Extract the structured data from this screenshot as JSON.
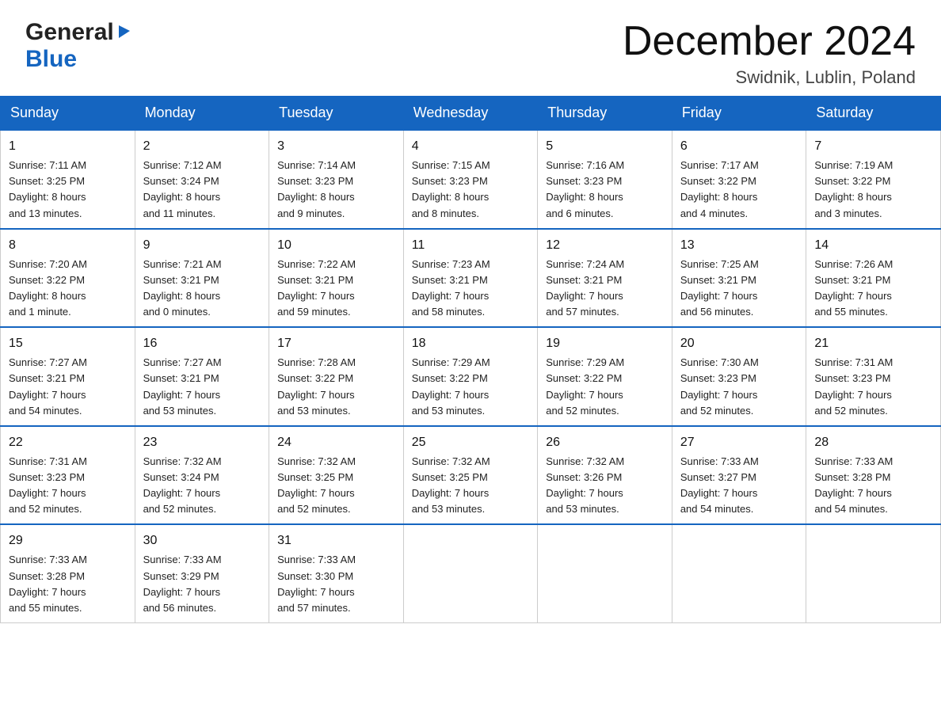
{
  "logo": {
    "general": "General",
    "blue": "Blue",
    "triangle": "▶"
  },
  "title": "December 2024",
  "location": "Swidnik, Lublin, Poland",
  "weekdays": [
    "Sunday",
    "Monday",
    "Tuesday",
    "Wednesday",
    "Thursday",
    "Friday",
    "Saturday"
  ],
  "weeks": [
    [
      {
        "day": "1",
        "info": "Sunrise: 7:11 AM\nSunset: 3:25 PM\nDaylight: 8 hours\nand 13 minutes."
      },
      {
        "day": "2",
        "info": "Sunrise: 7:12 AM\nSunset: 3:24 PM\nDaylight: 8 hours\nand 11 minutes."
      },
      {
        "day": "3",
        "info": "Sunrise: 7:14 AM\nSunset: 3:23 PM\nDaylight: 8 hours\nand 9 minutes."
      },
      {
        "day": "4",
        "info": "Sunrise: 7:15 AM\nSunset: 3:23 PM\nDaylight: 8 hours\nand 8 minutes."
      },
      {
        "day": "5",
        "info": "Sunrise: 7:16 AM\nSunset: 3:23 PM\nDaylight: 8 hours\nand 6 minutes."
      },
      {
        "day": "6",
        "info": "Sunrise: 7:17 AM\nSunset: 3:22 PM\nDaylight: 8 hours\nand 4 minutes."
      },
      {
        "day": "7",
        "info": "Sunrise: 7:19 AM\nSunset: 3:22 PM\nDaylight: 8 hours\nand 3 minutes."
      }
    ],
    [
      {
        "day": "8",
        "info": "Sunrise: 7:20 AM\nSunset: 3:22 PM\nDaylight: 8 hours\nand 1 minute."
      },
      {
        "day": "9",
        "info": "Sunrise: 7:21 AM\nSunset: 3:21 PM\nDaylight: 8 hours\nand 0 minutes."
      },
      {
        "day": "10",
        "info": "Sunrise: 7:22 AM\nSunset: 3:21 PM\nDaylight: 7 hours\nand 59 minutes."
      },
      {
        "day": "11",
        "info": "Sunrise: 7:23 AM\nSunset: 3:21 PM\nDaylight: 7 hours\nand 58 minutes."
      },
      {
        "day": "12",
        "info": "Sunrise: 7:24 AM\nSunset: 3:21 PM\nDaylight: 7 hours\nand 57 minutes."
      },
      {
        "day": "13",
        "info": "Sunrise: 7:25 AM\nSunset: 3:21 PM\nDaylight: 7 hours\nand 56 minutes."
      },
      {
        "day": "14",
        "info": "Sunrise: 7:26 AM\nSunset: 3:21 PM\nDaylight: 7 hours\nand 55 minutes."
      }
    ],
    [
      {
        "day": "15",
        "info": "Sunrise: 7:27 AM\nSunset: 3:21 PM\nDaylight: 7 hours\nand 54 minutes."
      },
      {
        "day": "16",
        "info": "Sunrise: 7:27 AM\nSunset: 3:21 PM\nDaylight: 7 hours\nand 53 minutes."
      },
      {
        "day": "17",
        "info": "Sunrise: 7:28 AM\nSunset: 3:22 PM\nDaylight: 7 hours\nand 53 minutes."
      },
      {
        "day": "18",
        "info": "Sunrise: 7:29 AM\nSunset: 3:22 PM\nDaylight: 7 hours\nand 53 minutes."
      },
      {
        "day": "19",
        "info": "Sunrise: 7:29 AM\nSunset: 3:22 PM\nDaylight: 7 hours\nand 52 minutes."
      },
      {
        "day": "20",
        "info": "Sunrise: 7:30 AM\nSunset: 3:23 PM\nDaylight: 7 hours\nand 52 minutes."
      },
      {
        "day": "21",
        "info": "Sunrise: 7:31 AM\nSunset: 3:23 PM\nDaylight: 7 hours\nand 52 minutes."
      }
    ],
    [
      {
        "day": "22",
        "info": "Sunrise: 7:31 AM\nSunset: 3:23 PM\nDaylight: 7 hours\nand 52 minutes."
      },
      {
        "day": "23",
        "info": "Sunrise: 7:32 AM\nSunset: 3:24 PM\nDaylight: 7 hours\nand 52 minutes."
      },
      {
        "day": "24",
        "info": "Sunrise: 7:32 AM\nSunset: 3:25 PM\nDaylight: 7 hours\nand 52 minutes."
      },
      {
        "day": "25",
        "info": "Sunrise: 7:32 AM\nSunset: 3:25 PM\nDaylight: 7 hours\nand 53 minutes."
      },
      {
        "day": "26",
        "info": "Sunrise: 7:32 AM\nSunset: 3:26 PM\nDaylight: 7 hours\nand 53 minutes."
      },
      {
        "day": "27",
        "info": "Sunrise: 7:33 AM\nSunset: 3:27 PM\nDaylight: 7 hours\nand 54 minutes."
      },
      {
        "day": "28",
        "info": "Sunrise: 7:33 AM\nSunset: 3:28 PM\nDaylight: 7 hours\nand 54 minutes."
      }
    ],
    [
      {
        "day": "29",
        "info": "Sunrise: 7:33 AM\nSunset: 3:28 PM\nDaylight: 7 hours\nand 55 minutes."
      },
      {
        "day": "30",
        "info": "Sunrise: 7:33 AM\nSunset: 3:29 PM\nDaylight: 7 hours\nand 56 minutes."
      },
      {
        "day": "31",
        "info": "Sunrise: 7:33 AM\nSunset: 3:30 PM\nDaylight: 7 hours\nand 57 minutes."
      },
      null,
      null,
      null,
      null
    ]
  ]
}
